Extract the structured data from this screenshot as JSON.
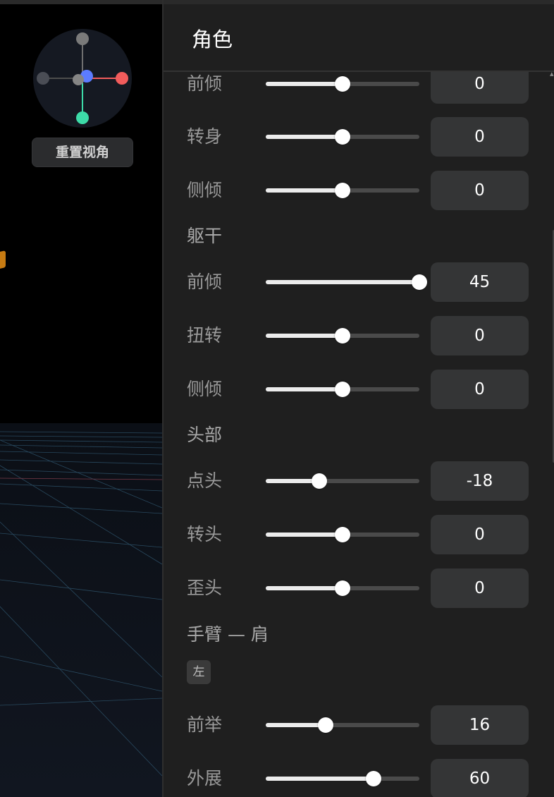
{
  "viewport": {
    "reset_view_label": "重置视角"
  },
  "panel": {
    "title": "角色",
    "side_tag": "左"
  },
  "groups": [
    {
      "title": "",
      "rows": [
        {
          "label": "前倾",
          "value": "0",
          "fraction": 0.5
        },
        {
          "label": "转身",
          "value": "0",
          "fraction": 0.5
        },
        {
          "label": "侧倾",
          "value": "0",
          "fraction": 0.5
        }
      ]
    },
    {
      "title": "躯干",
      "rows": [
        {
          "label": "前倾",
          "value": "45",
          "fraction": 1.0
        },
        {
          "label": "扭转",
          "value": "0",
          "fraction": 0.5
        },
        {
          "label": "侧倾",
          "value": "0",
          "fraction": 0.5
        }
      ]
    },
    {
      "title": "头部",
      "rows": [
        {
          "label": "点头",
          "value": "-18",
          "fraction": 0.35
        },
        {
          "label": "转头",
          "value": "0",
          "fraction": 0.5
        },
        {
          "label": "歪头",
          "value": "0",
          "fraction": 0.5
        }
      ]
    },
    {
      "title": "手臂 — 肩",
      "rows": [
        {
          "label": "前举",
          "value": "16",
          "fraction": 0.39
        },
        {
          "label": "外展",
          "value": "60",
          "fraction": 0.7
        }
      ]
    }
  ],
  "colors": {
    "axis_x": "#f25c5c",
    "axis_y": "#3ddba8",
    "axis_z": "#5c7cff",
    "accent_orange": "#c77b12"
  },
  "icons": {
    "orbit_gizmo": "axis-gizmo-icon",
    "scroll_up": "triangle-up-icon"
  }
}
